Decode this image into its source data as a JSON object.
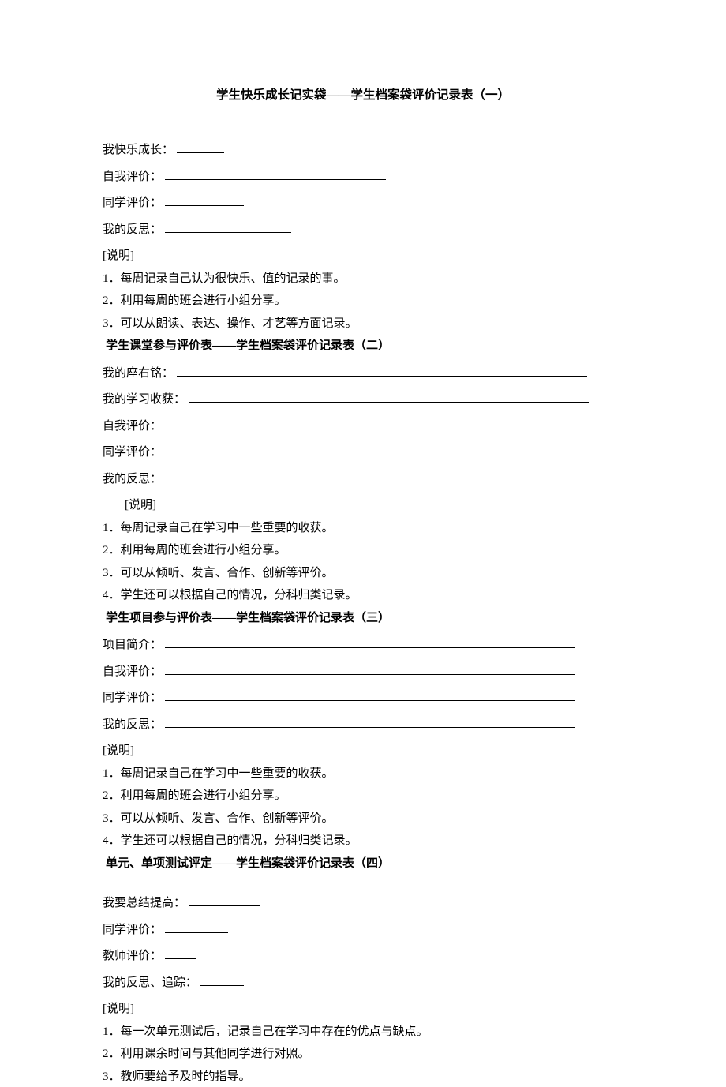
{
  "title": "学生快乐成长记实袋——学生档案袋评价记录表（一）",
  "s1": {
    "f1": "我快乐成长：",
    "f2": "自我评价：",
    "f3": "同学评价：",
    "f4": "我的反思：",
    "note_h": "[说明]",
    "n1": "1．每周记录自己认为很快乐、值的记录的事。",
    "n2": "2．利用每周的班会进行小组分享。",
    "n3": "3．可以从朗读、表达、操作、才艺等方面记录。"
  },
  "s2": {
    "title": "学生课堂参与评价表——学生档案袋评价记录表（二）",
    "f1": "我的座右铭：",
    "f2": "我的学习收获：",
    "f3": "自我评价：",
    "f4": "同学评价：",
    "f5": "我的反思：",
    "note_h": "[说明]",
    "n1": "1．每周记录自己在学习中一些重要的收获。",
    "n2": "2．利用每周的班会进行小组分享。",
    "n3": "3．可以从倾听、发言、合作、创新等评价。",
    "n4": "4．学生还可以根据自己的情况，分科归类记录。"
  },
  "s3": {
    "title": "学生项目参与评价表——学生档案袋评价记录表（三）",
    "f1": "项目简介：",
    "f2": "自我评价：",
    "f3": "同学评价：",
    "f4": "我的反思：",
    "note_h": "[说明]",
    "n1": "1．每周记录自己在学习中一些重要的收获。",
    "n2": "2．利用每周的班会进行小组分享。",
    "n3": "3．可以从倾听、发言、合作、创新等评价。",
    "n4": "4．学生还可以根据自己的情况，分科归类记录。"
  },
  "s4": {
    "title": "单元、单项测试评定——学生档案袋评价记录表（四）",
    "f1": "我要总结提高：",
    "f2": "同学评价：",
    "f3": "教师评价：",
    "f4": "我的反思、追踪：",
    "note_h": "[说明]",
    "n1": "1．每一次单元测试后，记录自己在学习中存在的优点与缺点。",
    "n2": "2．利用课余时间与其他同学进行对照。",
    "n3": "3．教师要给予及时的指导。"
  }
}
